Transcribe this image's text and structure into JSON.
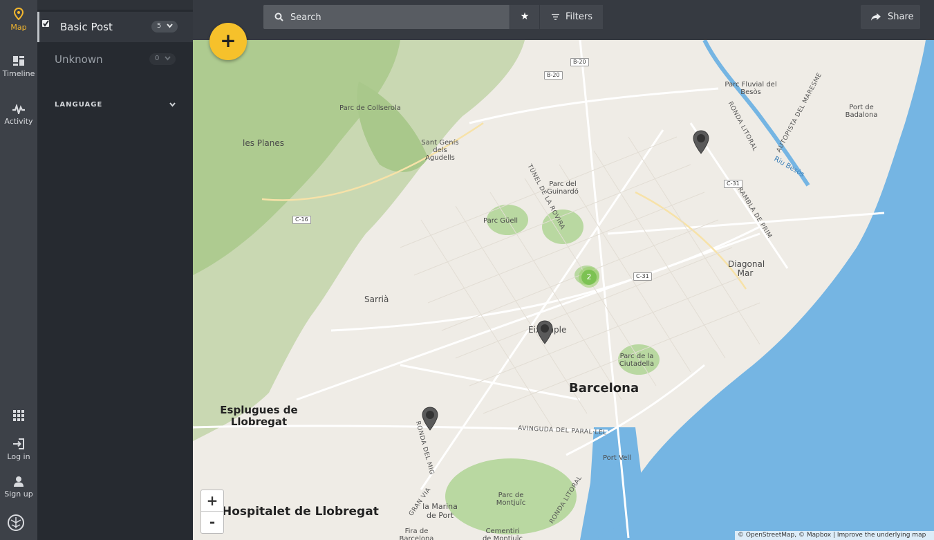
{
  "rail": {
    "map_label": "Map",
    "timeline_label": "Timeline",
    "activity_label": "Activity",
    "login_label": "Log in",
    "signup_label": "Sign up"
  },
  "filters": {
    "items": [
      {
        "label": "Basic Post",
        "count": "5",
        "checked": true
      },
      {
        "label": "Unknown",
        "count": "0",
        "checked": false
      }
    ],
    "language_title": "LANGUAGE"
  },
  "topbar": {
    "search_placeholder": "Search",
    "filters_label": "Filters",
    "share_label": "Share"
  },
  "map": {
    "cluster_count": "2",
    "zoom_in": "+",
    "zoom_out": "-",
    "attribution": "© OpenStreetMap, © Mapbox | Improve the underlying map",
    "places": {
      "barcelona": "Barcelona",
      "esplugues": "Esplugues de Llobregat",
      "hospitalet": "Hospitalet de Llobregat",
      "eixample": "Eixample",
      "sarria": "Sarrià",
      "les_planes": "les Planes",
      "parc_collserola": "Parc de Collserola",
      "sant_genis": "Sant Genís dels Agudells",
      "parc_guinardo": "Parc del Guinardó",
      "parc_guell": "Parc Güell",
      "parc_ciutadella": "Parc de la Ciutadella",
      "diagonal_mar": "Diagonal Mar",
      "parc_fluvial": "Parc Fluvial del Besòs",
      "port_badalona": "Port de Badalona",
      "port_vell": "Port Vell",
      "parc_montjuic": "Parc de Montjuïc",
      "la_marina": "la Marina de Port",
      "cementiri": "Cementiri de Montjuïc",
      "fira": "Fira de Barcelona",
      "riu_besos": "Riu Besòs"
    },
    "roads": {
      "b20_a": "B-20",
      "b20_b": "B-20",
      "c16": "C-16",
      "c31_a": "C-31",
      "c31_b": "C-31",
      "tunel_rovira": "TÚNEL DE LA ROVIRA",
      "ronda_litoral_n": "RONDA LITORAL",
      "autopista_maresme": "AUTOPISTA DEL MARESME",
      "rambla_prim": "RAMBLA DE PRIM",
      "paral_lel": "AVINGUDA DEL PARAL·LEL",
      "ronda_mig": "RONDA DEL MIG",
      "gran_via": "GRAN VIA",
      "ronda_litoral_s": "RONDA LITORAL"
    }
  },
  "colors": {
    "accent": "#f6c12b",
    "cluster": "#7cc253",
    "sea": "#75b5e3",
    "park": "#b9d8a1"
  }
}
